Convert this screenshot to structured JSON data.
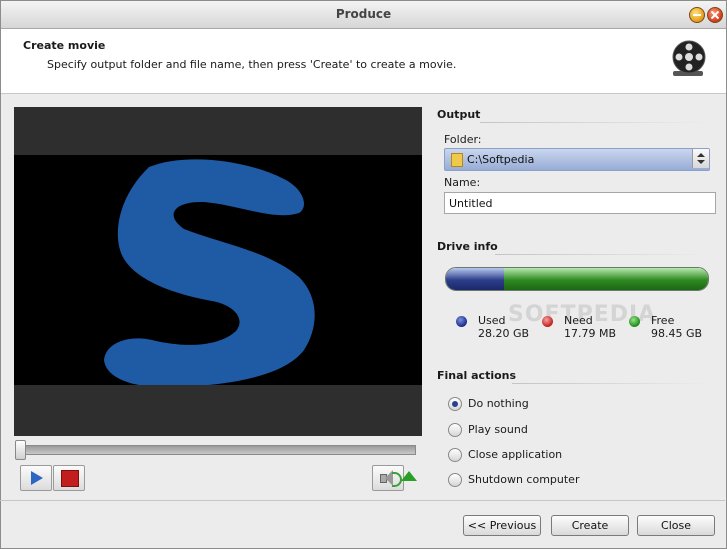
{
  "window": {
    "title": "Produce"
  },
  "header": {
    "title": "Create movie",
    "subtitle": "Specify output folder and file name, then press 'Create' to create a movie."
  },
  "output": {
    "heading": "Output",
    "folder_label": "Folder:",
    "folder_value": "C:\\Softpedia",
    "name_label": "Name:",
    "name_value": "Untitled"
  },
  "drive_info": {
    "heading": "Drive info",
    "used_fraction": 0.22,
    "legend": [
      {
        "label": "Used",
        "value": "28.20 GB",
        "color": "#1a2a8a"
      },
      {
        "label": "Need",
        "value": "17.79 MB",
        "color": "#c21e1e"
      },
      {
        "label": "Free",
        "value": "98.45 GB",
        "color": "#1a8a14"
      }
    ],
    "watermark": "SOFTPEDIA"
  },
  "final_actions": {
    "heading": "Final actions",
    "options": [
      "Do nothing",
      "Play sound",
      "Close application",
      "Shutdown computer"
    ],
    "selected": "Do nothing"
  },
  "player": {
    "position": 0,
    "video_color": "#1f5aa4"
  },
  "buttons": {
    "previous": "<< Previous",
    "create": "Create",
    "close": "Close"
  },
  "icons": {
    "play": "play-icon",
    "stop": "stop-icon",
    "volume": "speaker-icon",
    "volume_slider": "volume-triangle-icon",
    "folder": "folder-icon",
    "film_reel": "film-reel-icon"
  }
}
